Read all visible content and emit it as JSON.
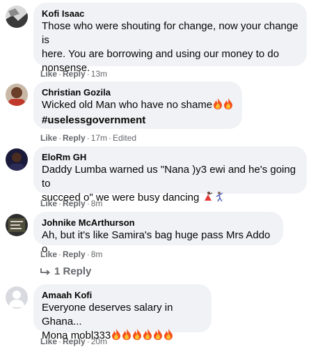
{
  "comments": [
    {
      "author": "Kofi Isaac",
      "lines": [
        "Those who were shouting for change, now your change is",
        "here. You are borrowing and using our money to do",
        "nonsense."
      ],
      "like": "Like",
      "reply": "Reply",
      "time": "13m"
    },
    {
      "author": "Christian Gozila",
      "line1": "Wicked old Man who have no shame",
      "hashtag": "#uselessgovernment",
      "like": "Like",
      "reply": "Reply",
      "time": "17m",
      "edited": "Edited"
    },
    {
      "author": "EloRm GH",
      "line1": "Daddy Lumba warned us \"Nana )y3 ewi and he's going to",
      "line2": "succeed o\" we were busy dancing",
      "like": "Like",
      "reply": "Reply",
      "time": "8m"
    },
    {
      "author": "Johnike McArthurson",
      "line1": "Ah, but it's like Samira's bag huge pass Mrs Addo o",
      "like": "Like",
      "reply": "Reply",
      "time": "8m",
      "replies_link": "1 Reply"
    },
    {
      "author": "Amaah Kofi",
      "line1": "Everyone deserves salary in Ghana...",
      "line2": "Mona mobl333",
      "like": "Like",
      "reply": "Reply",
      "time": "20m"
    }
  ],
  "icons": {
    "fire": "fire-emoji",
    "dancer": "woman-dancing-emoji",
    "man_dancing": "man-dancing-emoji",
    "reply_arrow": "reply-arrow-icon"
  }
}
